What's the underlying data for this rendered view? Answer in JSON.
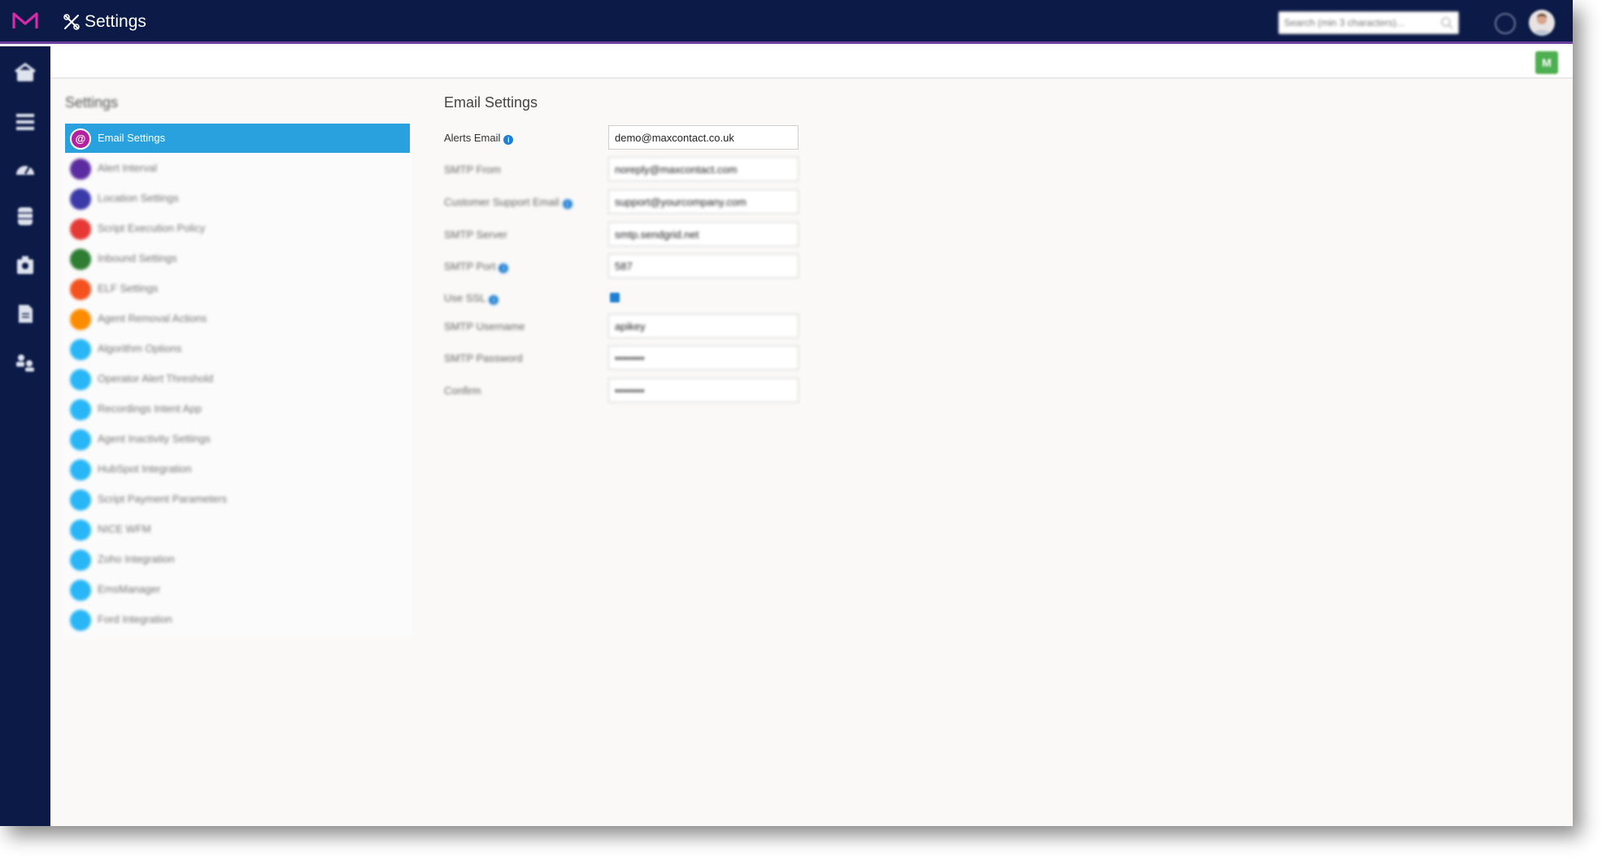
{
  "app": {
    "title": "Settings",
    "search_placeholder": "Search (min 3 characters)...",
    "excel_label": "M"
  },
  "colors": {
    "topbar": "#0b1a47",
    "accent_active": "#29a1de",
    "brand_logo": "#d62aa8"
  },
  "left_nav_icons": [
    "home-icon",
    "list-icon",
    "dashboard-gauge-icon",
    "database-icon",
    "contacts-icon",
    "document-icon",
    "users-icon"
  ],
  "settings_list": {
    "heading": "Settings",
    "items": [
      {
        "label": "Email Settings",
        "icon_glyph": "@",
        "color": "#b4219e"
      },
      {
        "label": "Alert Interval",
        "icon_glyph": "",
        "color": "#5b2ca0"
      },
      {
        "label": "Location Settings",
        "icon_glyph": "",
        "color": "#3b3aa8"
      },
      {
        "label": "Script Execution Policy",
        "icon_glyph": "",
        "color": "#e53935"
      },
      {
        "label": "Inbound Settings",
        "icon_glyph": "",
        "color": "#2e7d32"
      },
      {
        "label": "ELF Settings",
        "icon_glyph": "",
        "color": "#f4511e"
      },
      {
        "label": "Agent Removal Actions",
        "icon_glyph": "",
        "color": "#fb8c00"
      },
      {
        "label": "Algorithm Options",
        "icon_glyph": "",
        "color": "#29b6f6"
      },
      {
        "label": "Operator Alert Threshold",
        "icon_glyph": "",
        "color": "#29b6f6"
      },
      {
        "label": "Recordings Intent App",
        "icon_glyph": "",
        "color": "#29b6f6"
      },
      {
        "label": "Agent Inactivity Settings",
        "icon_glyph": "",
        "color": "#29b6f6"
      },
      {
        "label": "HubSpot Integration",
        "icon_glyph": "",
        "color": "#29b6f6"
      },
      {
        "label": "Script Payment Parameters",
        "icon_glyph": "",
        "color": "#29b6f6"
      },
      {
        "label": "NICE WFM",
        "icon_glyph": "",
        "color": "#29b6f6"
      },
      {
        "label": "Zoho Integration",
        "icon_glyph": "",
        "color": "#29b6f6"
      },
      {
        "label": "EmsManager",
        "icon_glyph": "",
        "color": "#29b6f6"
      },
      {
        "label": "Ford Integration",
        "icon_glyph": "",
        "color": "#29b6f6"
      }
    ]
  },
  "form": {
    "title": "Email Settings",
    "fields": [
      {
        "label": "Alerts Email",
        "value": "demo@maxcontact.co.uk",
        "info": true
      },
      {
        "label": "SMTP From",
        "value": "noreply@maxcontact.com",
        "info": false
      },
      {
        "label": "Customer Support Email",
        "value": "support@yourcompany.com",
        "info": true
      },
      {
        "label": "SMTP Server",
        "value": "smtp.sendgrid.net",
        "info": false
      },
      {
        "label": "SMTP Port",
        "value": "587",
        "info": true
      },
      {
        "label": "Use SSL",
        "value": "",
        "info": true,
        "checked": true
      },
      {
        "label": "SMTP Username",
        "value": "apikey",
        "info": false
      },
      {
        "label": "SMTP Password",
        "value": "••••••••",
        "info": false
      },
      {
        "label": "Confirm",
        "value": "••••••••",
        "info": false
      }
    ],
    "info_glyph": "i"
  }
}
